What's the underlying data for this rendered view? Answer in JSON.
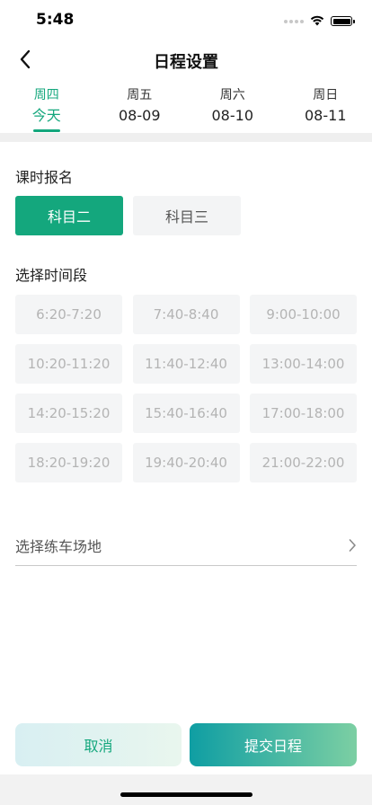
{
  "status_bar": {
    "time": "5:48",
    "icons": [
      "signal-dots-icon",
      "wifi-icon",
      "battery-icon"
    ]
  },
  "nav": {
    "back_icon": "chevron-left-icon",
    "title": "日程设置"
  },
  "date_tabs": [
    {
      "weekday": "周四",
      "date": "今天",
      "active": true
    },
    {
      "weekday": "周五",
      "date": "08-09",
      "active": false
    },
    {
      "weekday": "周六",
      "date": "08-10",
      "active": false
    },
    {
      "weekday": "周日",
      "date": "08-11",
      "active": false
    }
  ],
  "subject_section": {
    "label": "课时报名",
    "options": [
      {
        "label": "科目二",
        "selected": true
      },
      {
        "label": "科目三",
        "selected": false
      }
    ]
  },
  "time_section": {
    "label": "选择时间段",
    "slots": [
      "6:20-7:20",
      "7:40-8:40",
      "9:00-10:00",
      "10:20-11:20",
      "11:40-12:40",
      "13:00-14:00",
      "14:20-15:20",
      "15:40-16:40",
      "17:00-18:00",
      "18:20-19:20",
      "19:40-20:40",
      "21:00-22:00"
    ]
  },
  "venue": {
    "label": "选择练车场地",
    "icon": "chevron-right-icon"
  },
  "actions": {
    "cancel": "取消",
    "submit": "提交日程"
  },
  "colors": {
    "accent": "#14a77d",
    "slot_text": "#b4b4b4"
  }
}
